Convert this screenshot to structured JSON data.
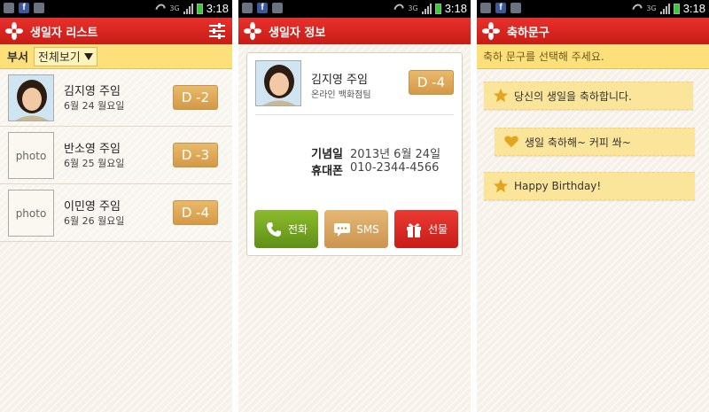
{
  "status_bar": {
    "time": "3:18",
    "network": "3G",
    "fb": "f"
  },
  "screen1": {
    "title": "생일자 리스트",
    "filter_label": "부서",
    "filter_value": "전체보기",
    "items": [
      {
        "name": "김지영 주임",
        "date": "6월 24 월요일",
        "dday": "D -2",
        "photo": ""
      },
      {
        "name": "반소영 주임",
        "date": "6월 25 월요일",
        "dday": "D -3",
        "photo": "photo"
      },
      {
        "name": "이민영 주임",
        "date": "6월 26 월요일",
        "dday": "D -4",
        "photo": "photo"
      }
    ]
  },
  "screen2": {
    "title": "생일자 정보",
    "name": "김지영 주임",
    "dept": "온라인 백화점팀",
    "dday": "D -4",
    "anniv_label": "기념일",
    "anniv_value": "2013년 6월 24일",
    "phone_label": "휴대폰",
    "phone_value": "010-2344-4566",
    "buttons": {
      "call": "전화",
      "sms": "SMS",
      "gift": "선물"
    }
  },
  "screen3": {
    "title": "축하문구",
    "hint": "축하 문구를 선택해 주세요.",
    "messages": [
      {
        "text": "당신의 생일을 축하합니다.",
        "icon": "star-icon"
      },
      {
        "text": "생일 축하해~ 커피 쏴~",
        "icon": "heart-icon"
      },
      {
        "text": "Happy Birthday!",
        "icon": "star-icon"
      }
    ]
  },
  "colors": {
    "header": "#d3231e",
    "accent_bar": "#fde07a",
    "dday": "#d9a04f",
    "call": "#78a722",
    "gift": "#d8261f"
  }
}
